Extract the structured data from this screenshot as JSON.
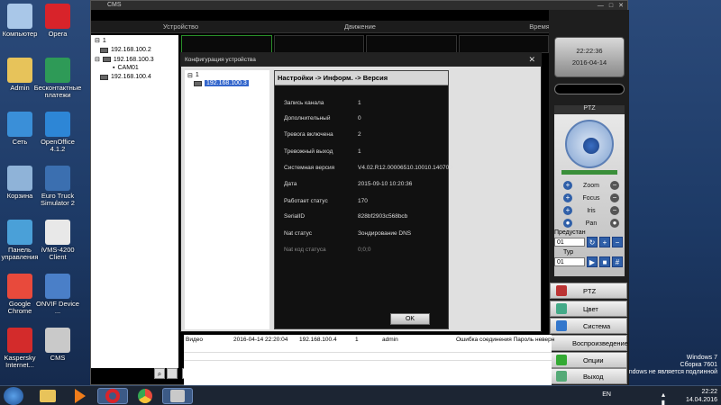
{
  "desktop_icons": [
    {
      "label": "Компьютер",
      "icon": "computer-icon",
      "color": "#a9c7e8"
    },
    {
      "label": "Opera",
      "icon": "opera-icon",
      "color": "#d8232a"
    },
    {
      "label": "Admin",
      "icon": "user-folder-icon",
      "color": "#e7c35a"
    },
    {
      "label": "Бесконтактные платежи",
      "icon": "payment-icon",
      "color": "#2e9a57"
    },
    {
      "label": "Сеть",
      "icon": "network-icon",
      "color": "#3a8fd8"
    },
    {
      "label": "OpenOffice 4.1.2",
      "icon": "openoffice-icon",
      "color": "#2d86d6"
    },
    {
      "label": "Корзина",
      "icon": "recycle-bin-icon",
      "color": "#8fb3d8"
    },
    {
      "label": "Euro Truck Simulator 2",
      "icon": "truck-icon",
      "color": "#3b6fb0"
    },
    {
      "label": "Панель управления",
      "icon": "control-panel-icon",
      "color": "#4aa0d8"
    },
    {
      "label": "iVMS-4200 Client",
      "icon": "camera-icon",
      "color": "#e8e8e8"
    },
    {
      "label": "Google Chrome",
      "icon": "chrome-icon",
      "color": "#e84a3c"
    },
    {
      "label": "ONVIF Device ...",
      "icon": "shield-icon",
      "color": "#4a7fc8"
    },
    {
      "label": "Kaspersky Internet...",
      "icon": "kaspersky-icon",
      "color": "#d32b2b"
    },
    {
      "label": "CMS",
      "icon": "cms-icon",
      "color": "#c9c9c9"
    }
  ],
  "cms": {
    "title": "CMS",
    "menu": [
      "Устройство",
      "Движение",
      "Время"
    ],
    "tree": {
      "root": "1",
      "devices": [
        "192.168.100.2",
        "192.168.100.3",
        "CAM01",
        "192.168.100.4"
      ]
    },
    "clock": {
      "time": "22:22:36",
      "date": "2016-04-14"
    },
    "ptz": {
      "title": "PTZ",
      "controls": [
        "Zoom",
        "Focus",
        "Iris",
        "Pan"
      ],
      "preset_label": "Предустан",
      "preset_value": "01",
      "tour_label": "Тур",
      "tour_value": "01"
    },
    "side_buttons": [
      "PTZ",
      "Цвет",
      "Система",
      "Воспроизведение",
      "Опции",
      "Выход"
    ],
    "log": {
      "type": "Видео",
      "time": "2016-04-14 22:20:04",
      "ip": "192.168.100.4",
      "channel": "1",
      "user": "admin",
      "message": "Ошибка соединения Пароль неверн"
    }
  },
  "dialog": {
    "title": "Конфигурация устройства",
    "tree_root": "1",
    "tree_item": "192.168.100.3",
    "breadcrumb": "Настройки -> Информ. -> Версия",
    "rows": [
      {
        "label": "Запись канала",
        "value": "1"
      },
      {
        "label": "Дополнительный",
        "value": "0"
      },
      {
        "label": "Тревога включена",
        "value": "2"
      },
      {
        "label": "Тревожный выход",
        "value": "1"
      },
      {
        "label": "Системная версия",
        "value": "V4.02.R12.00006510.10010.140700"
      },
      {
        "label": "Дата",
        "value": "2015-09-10 10:20:36"
      },
      {
        "label": "Работает статус",
        "value": "170"
      },
      {
        "label": "SerialID",
        "value": "828bf2903c568bcb"
      },
      {
        "label": "Nat статус",
        "value": "Зондирование DNS"
      },
      {
        "label": "Nat код статуса",
        "value": "0;0;0"
      }
    ],
    "ok_label": "OK"
  },
  "taskbar": {
    "lang": "EN",
    "time": "22:22",
    "date": "14.04.2016",
    "apps": [
      "explorer-icon",
      "media-player-icon",
      "opera-icon",
      "chrome-icon",
      "cms-icon"
    ]
  },
  "watermark": {
    "line1": "Windows 7",
    "line2": "Сборка 7601",
    "line3": "ndows не является подлинной"
  }
}
